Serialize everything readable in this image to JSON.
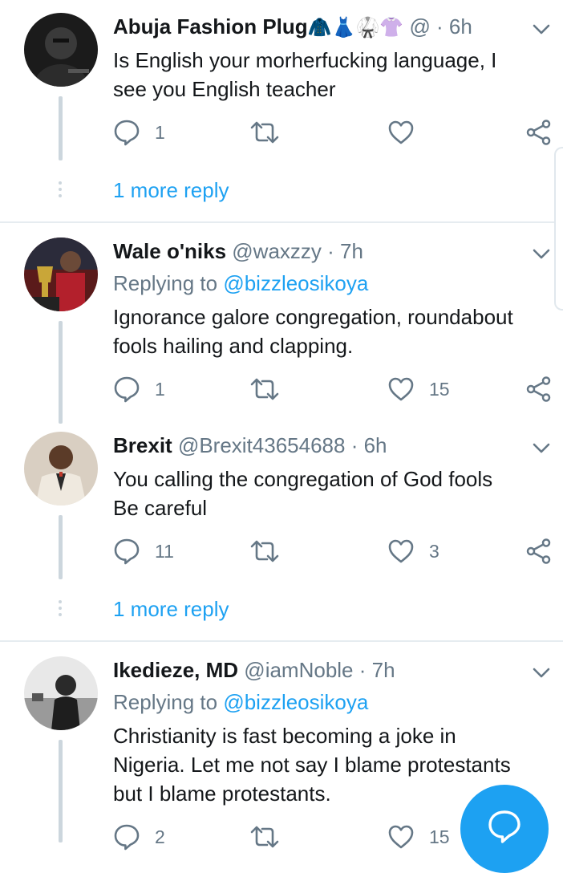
{
  "colors": {
    "accent": "#1da1f2",
    "secondary_text": "#657786",
    "line": "#ccd6dd"
  },
  "tweets": [
    {
      "name": "Abuja Fashion Plug",
      "name_emoji": "🧥👗🥋👚",
      "handle": "@ · 6h",
      "body_lines": [
        "Is English your morherfucking language, I",
        "see you English teacher"
      ],
      "replies": "1",
      "retweets": "",
      "likes": "",
      "more_replies": "1 more reply",
      "avatar_icon": "person-avatar-dark"
    },
    {
      "name": "Wale o'niks",
      "handle": "@waxzzy · 7h",
      "replying_prefix": "Replying to ",
      "replying_to": "@bizzleosikoya",
      "body_lines": [
        "Ignorance galore congregation, roundabout",
        "fools hailing and clapping."
      ],
      "replies": "1",
      "retweets": "",
      "likes": "15",
      "avatar_icon": "person-with-trophy-avatar"
    },
    {
      "name": "Brexit",
      "handle": "@Brexit43654688 · 6h",
      "body_lines": [
        "You calling the congregation of God fools",
        "Be careful"
      ],
      "replies": "11",
      "retweets": "",
      "likes": "3",
      "more_replies": "1 more reply",
      "avatar_icon": "person-in-suit-avatar"
    },
    {
      "name": "Ikedieze, MD",
      "handle": "@iamNoble · 7h",
      "replying_prefix": "Replying to ",
      "replying_to": "@bizzleosikoya",
      "body_lines": [
        "Christianity is fast becoming a joke in",
        "Nigeria. Let me not say I blame protestants",
        "but I blame protestants."
      ],
      "replies": "2",
      "retweets": "",
      "likes": "15",
      "avatar_icon": "person-grayscale-avatar"
    }
  ],
  "compose_button": {
    "icon": "speech-bubble-icon"
  }
}
